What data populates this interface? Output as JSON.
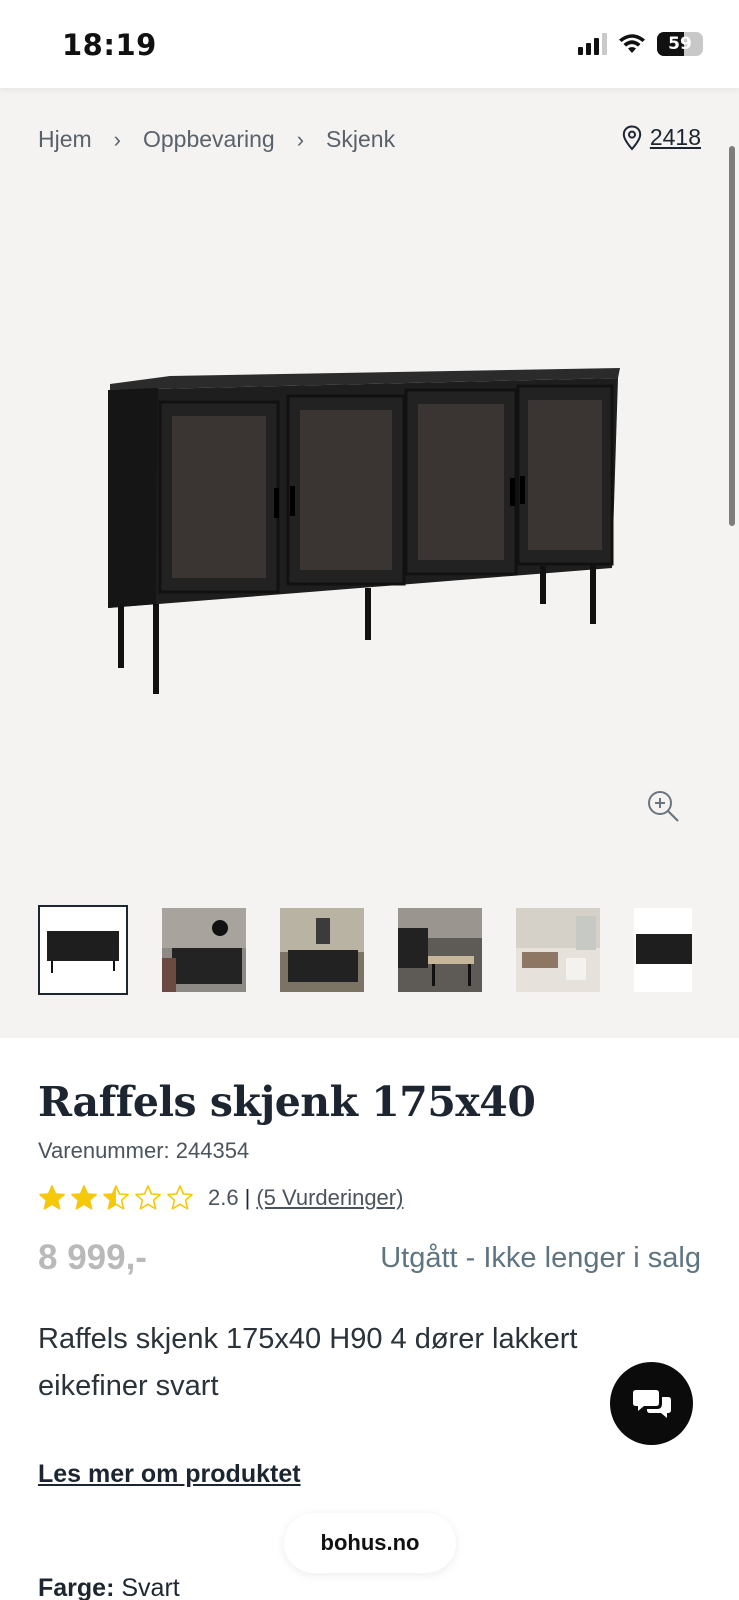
{
  "status_bar": {
    "time": "18:19",
    "battery": "59",
    "battery_level": 0.59
  },
  "breadcrumb": {
    "items": [
      "Hjem",
      "Oppbevaring",
      "Skjenk"
    ]
  },
  "store": {
    "number": "2418"
  },
  "product": {
    "title": "Raffels skjenk 175x40",
    "sku": "Varenummer: 244354",
    "rating": {
      "stars": 2.5,
      "score": "2.6",
      "separator": "|",
      "reviews": "(5 Vurderinger)"
    },
    "price": "8 999,-",
    "availability": "Utgått - Ikke lenger i salg",
    "description": "Raffels skjenk 175x40 H90 4 dører lakkert eikefiner svart",
    "read_more": "Les mer om produktet",
    "color_label": "Farge:",
    "color_value": "Svart"
  },
  "thumbnails": [
    "product-front",
    "lifestyle-wall",
    "lifestyle-room",
    "lifestyle-dining",
    "lifestyle-living",
    "product-side"
  ],
  "floating": {
    "site": "bohus.no"
  },
  "colors": {
    "accent_star": "#f6c80a",
    "text_dark": "#1c2530",
    "price_disabled": "#b9b9b9",
    "availability": "#5f7480",
    "gallery_bg": "#f5f3f1"
  }
}
